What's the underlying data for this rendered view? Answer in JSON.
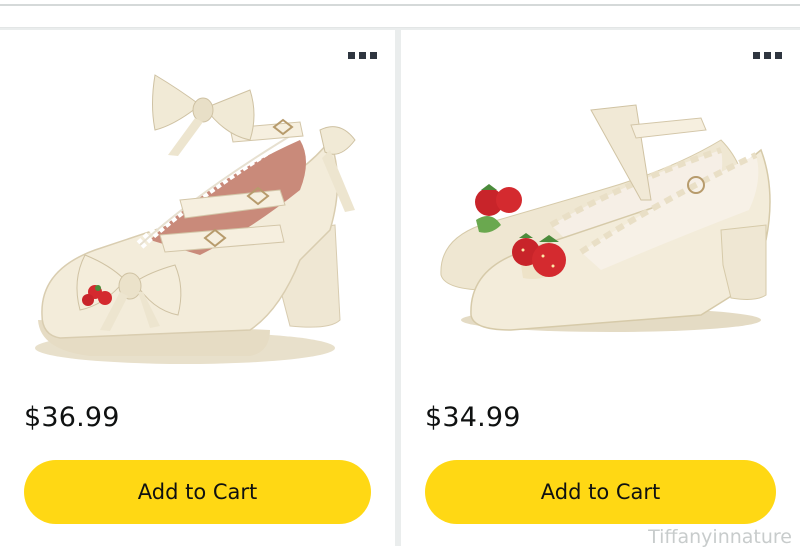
{
  "products": [
    {
      "price": "$36.99",
      "cart_label": "Add to Cart",
      "image_icon": "lolita-bow-shoe-image"
    },
    {
      "price": "$34.99",
      "cart_label": "Add to Cart",
      "image_icon": "strawberry-shoe-image"
    }
  ],
  "watermark": "Tiffanyinnature",
  "colors": {
    "button": "#ffd814",
    "shoe": "#f1ebd9",
    "strawberry": "#d42a2f",
    "card_bg": "#ffffff",
    "page_bg": "#eaeded"
  }
}
